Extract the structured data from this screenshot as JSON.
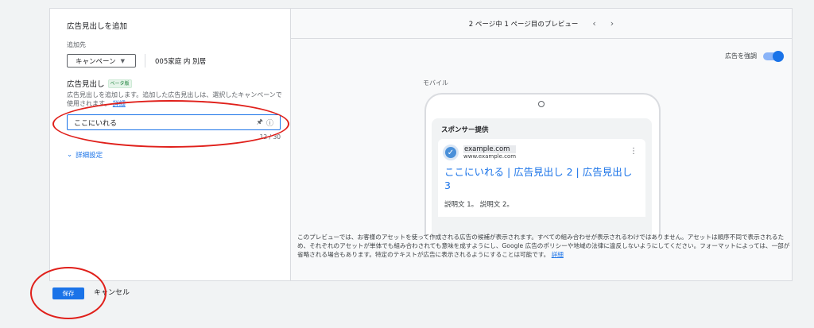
{
  "left": {
    "title": "広告見出しを追加",
    "add_to_label": "追加先",
    "campaign_dropdown": "キャンペーン",
    "campaign_name": "005家庭 内 別居",
    "headline_label": "広告見出し",
    "headline_badge": "ベータ版",
    "description": "広告見出しを追加します。追加した広告見出しは、選択したキャンペーンで使用されます。",
    "description_link": "詳細",
    "headline_value": "ここにいれる",
    "counter": "12 / 30",
    "advanced_settings": "詳細設定"
  },
  "preview": {
    "page_indicator": "2 ページ中 1 ページ目のプレビュー",
    "highlight_label": "広告を強調",
    "highlight_on": true,
    "device_label": "モバイル",
    "sponsored": "スポンサー提供",
    "domain": "example.com",
    "domain_sub": "www.example.com",
    "ad_title": "ここにいれる | 広告見出し 2 | 広告見出し 3",
    "ad_description": "説明文 1。 説明文 2。",
    "disclaimer": "このプレビューでは、お客様のアセットを使って作成される広告の候補が表示されます。すべての組み合わせが表示されるわけではありません。アセットは順序不同で表示されるため、それぞれのアセットが単体でも組み合わされても意味を成すようにし、Google 広告のポリシーや地域の法律に違反しないようにしてください。フォーマットによっては、一部が省略される場合もあります。特定のテキストが広告に表示されるようにすることは可能です。",
    "disclaimer_link": "詳細"
  },
  "footer": {
    "save": "保存",
    "cancel": "キャンセル"
  },
  "colors": {
    "accent": "#1a73e8",
    "annotation_red": "#e0201b"
  }
}
